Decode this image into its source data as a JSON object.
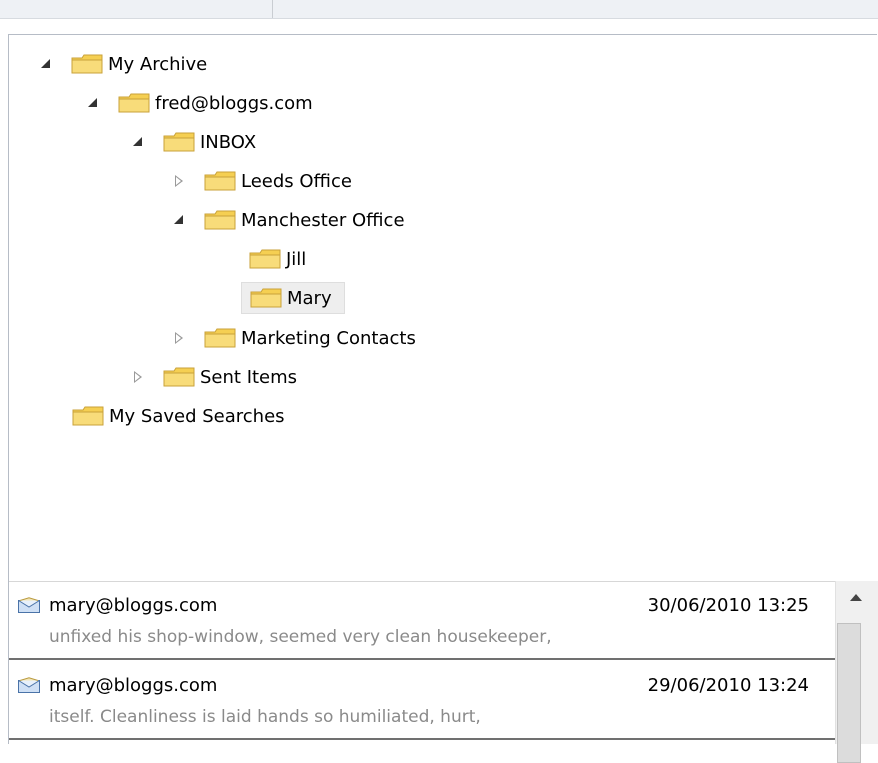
{
  "tree": {
    "nodes": [
      {
        "label": "My Archive",
        "state": "expanded"
      },
      {
        "label": "fred@bloggs.com",
        "state": "expanded"
      },
      {
        "label": "INBOX",
        "state": "expanded"
      },
      {
        "label": "Leeds Office",
        "state": "collapsed"
      },
      {
        "label": "Manchester Office",
        "state": "expanded"
      },
      {
        "label": "Jill",
        "state": "leaf"
      },
      {
        "label": "Mary",
        "state": "leaf",
        "selected": true
      },
      {
        "label": "Marketing Contacts",
        "state": "collapsed"
      },
      {
        "label": "Sent Items",
        "state": "collapsed"
      },
      {
        "label": "My Saved Searches",
        "state": "leaf"
      }
    ]
  },
  "messages": [
    {
      "from": "mary@bloggs.com",
      "date": "30/06/2010 13:25",
      "snippet": "unfixed his shop-window, seemed very clean housekeeper,"
    },
    {
      "from": "mary@bloggs.com",
      "date": "29/06/2010 13:24",
      "snippet": "itself. Cleanliness is laid hands so humiliated, hurt,"
    }
  ],
  "icons": {
    "folder": "folder-icon",
    "message": "envelope-icon",
    "scroll_up": "scroll-up-arrow-icon"
  },
  "colors": {
    "folder": "#f5cf52",
    "folder_edge": "#c9a23a",
    "selection": "#eeeeee"
  }
}
